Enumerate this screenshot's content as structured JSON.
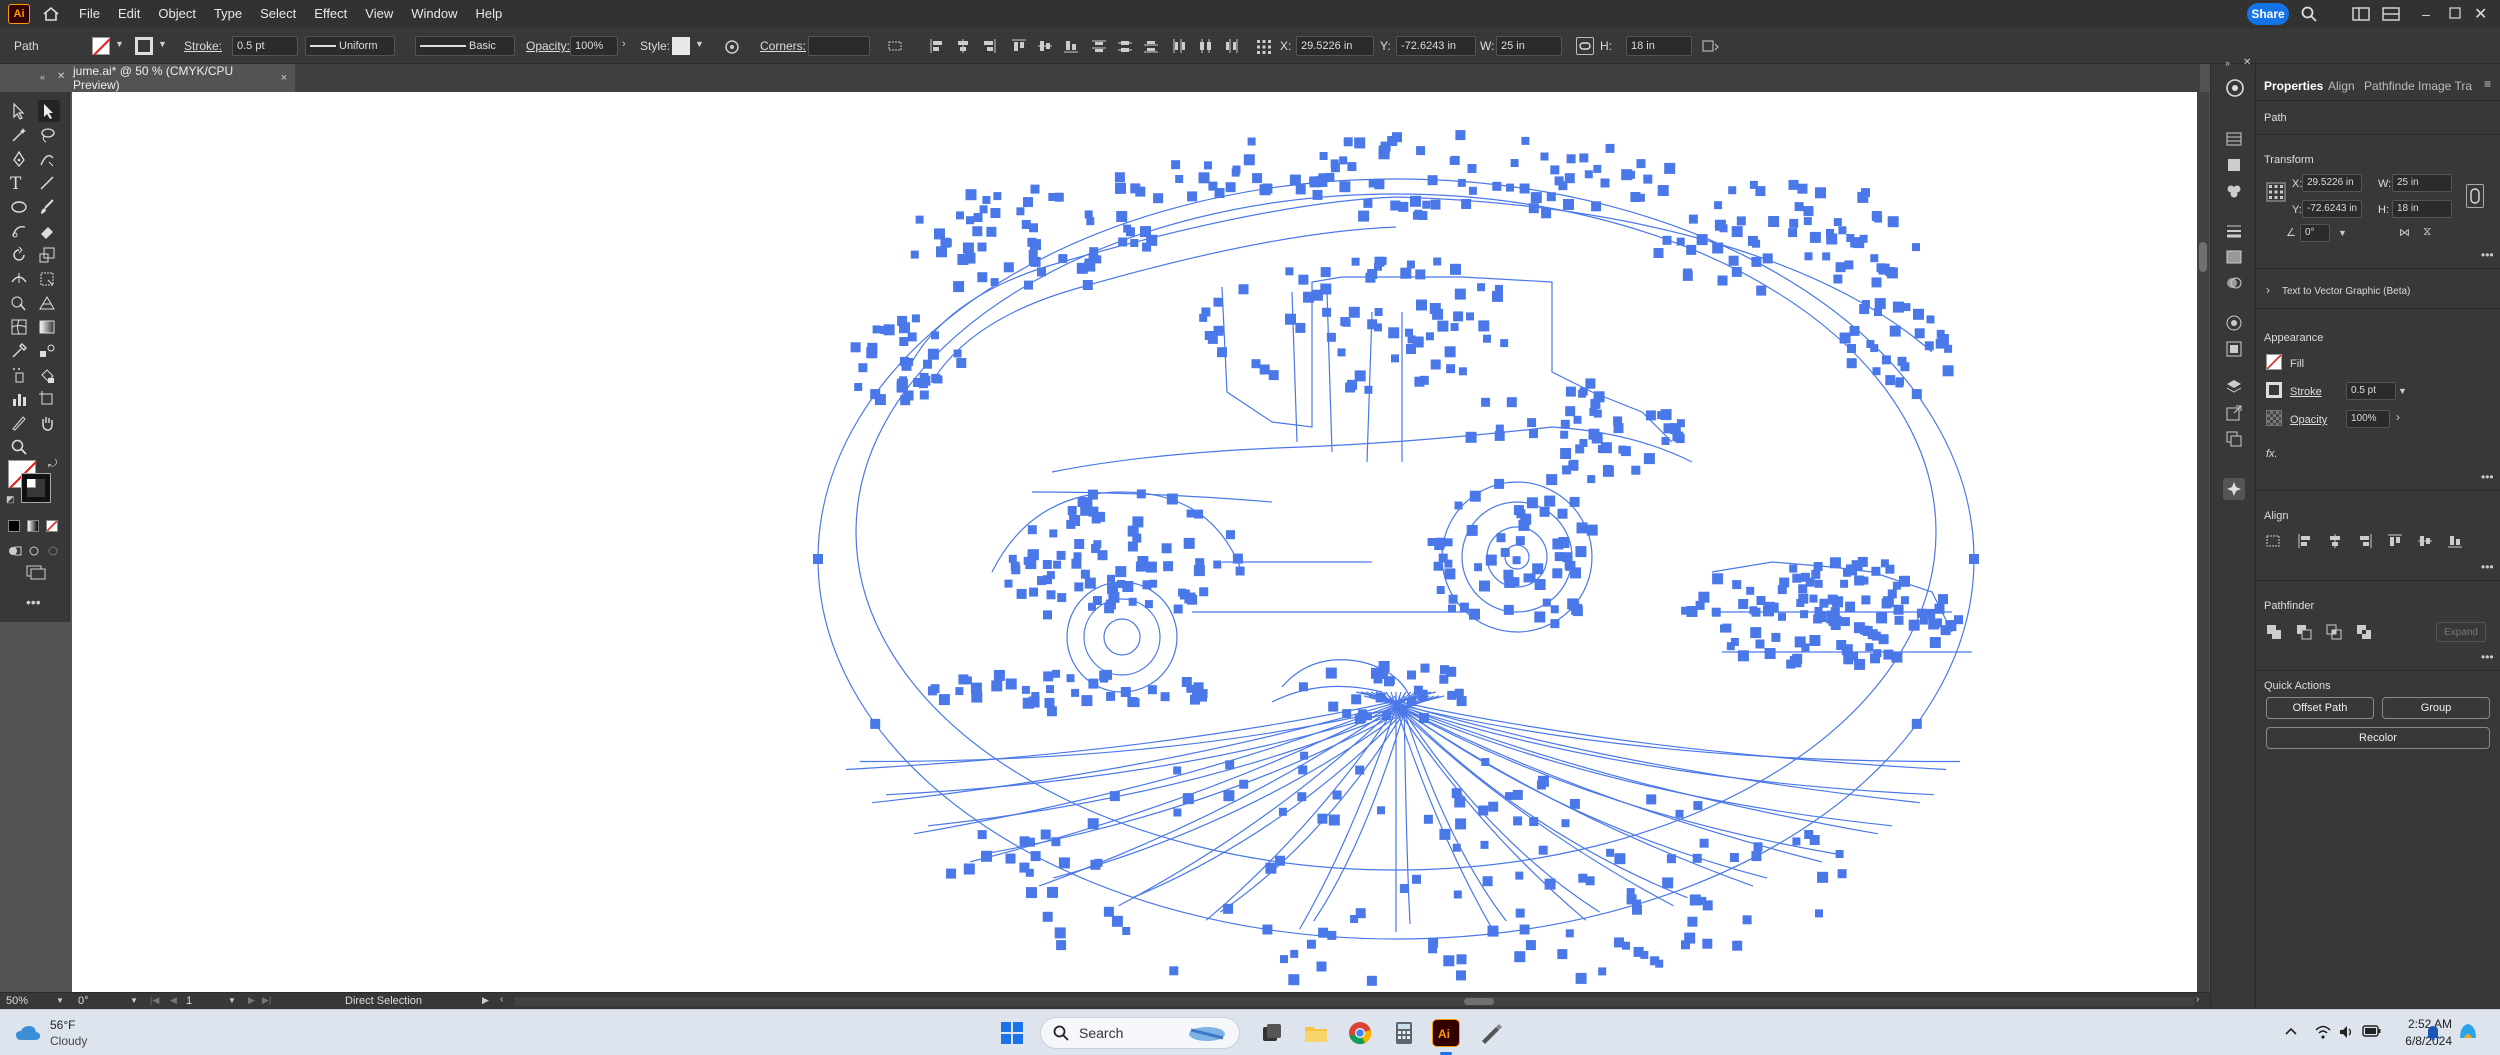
{
  "app": {
    "logo": "Ai"
  },
  "menu": [
    "File",
    "Edit",
    "Object",
    "Type",
    "Select",
    "Effect",
    "View",
    "Window",
    "Help"
  ],
  "share_label": "Share",
  "control": {
    "selection": "Path",
    "stroke_label": "Stroke:",
    "stroke_value": "0.5 pt",
    "profile": "Uniform",
    "brush": "Basic",
    "opacity_label": "Opacity:",
    "opacity_value": "100%",
    "style_label": "Style:",
    "corners_label": "Corners:",
    "x_label": "X:",
    "x_value": "29.5226 in",
    "y_label": "Y:",
    "y_value": "-72.6243 in",
    "w_label": "W:",
    "w_value": "25 in",
    "h_label": "H:",
    "h_value": "18 in"
  },
  "doc_tab": {
    "title": "jume.ai* @ 50 % (CMYK/CPU Preview)",
    "close": "×"
  },
  "properties": {
    "tabs": [
      "Properties",
      "Align",
      "Pathfinde",
      "Image Tra"
    ],
    "selection": "Path",
    "transform_title": "Transform",
    "x_label": "X:",
    "x_value": "29.5226 in",
    "y_label": "Y:",
    "y_value": "-72.6243 in",
    "w_label": "W:",
    "w_value": "25 in",
    "h_label": "H:",
    "h_value": "18 in",
    "angle_value": "0°",
    "text_to_vector": "Text to Vector Graphic (Beta)",
    "appearance_title": "Appearance",
    "fill_label": "Fill",
    "stroke_label": "Stroke",
    "stroke_value": "0.5 pt",
    "opacity_label": "Opacity",
    "opacity_value": "100%",
    "fx_label": "fx.",
    "align_title": "Align",
    "pathfinder_title": "Pathfinder",
    "expand_label": "Expand",
    "quick_actions_title": "Quick Actions",
    "offset_path": "Offset Path",
    "group": "Group",
    "recolor": "Recolor"
  },
  "status": {
    "zoom": "50%",
    "rotation": "0°",
    "artboard": "1",
    "tool": "Direct Selection"
  },
  "taskbar": {
    "weather_temp": "56°F",
    "weather_desc": "Cloudy",
    "search_placeholder": "Search",
    "time": "2:52 AM",
    "date": "6/8/2024"
  },
  "colors": {
    "selection_blue": "#4a78e8",
    "share_blue": "#1473e6",
    "ui_dark": "#383838",
    "menubar": "#323232"
  }
}
